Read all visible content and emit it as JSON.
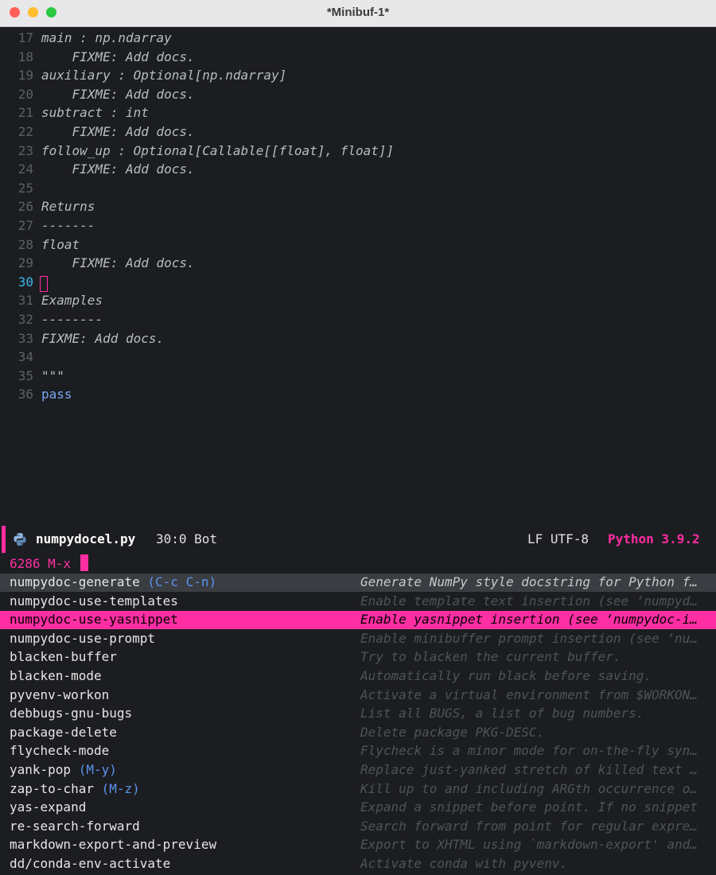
{
  "window": {
    "title": "*Minibuf-1*"
  },
  "editor": {
    "lines": [
      {
        "num": "17",
        "text": "main : np.ndarray"
      },
      {
        "num": "18",
        "text": "    FIXME: Add docs."
      },
      {
        "num": "19",
        "text": "auxiliary : Optional[np.ndarray]"
      },
      {
        "num": "20",
        "text": "    FIXME: Add docs."
      },
      {
        "num": "21",
        "text": "subtract : int"
      },
      {
        "num": "22",
        "text": "    FIXME: Add docs."
      },
      {
        "num": "23",
        "text": "follow_up : Optional[Callable[[float], float]]"
      },
      {
        "num": "24",
        "text": "    FIXME: Add docs."
      },
      {
        "num": "25",
        "text": ""
      },
      {
        "num": "26",
        "text": "Returns"
      },
      {
        "num": "27",
        "text": "-------"
      },
      {
        "num": "28",
        "text": "float"
      },
      {
        "num": "29",
        "text": "    FIXME: Add docs."
      },
      {
        "num": "30",
        "text": ""
      },
      {
        "num": "31",
        "text": "Examples"
      },
      {
        "num": "32",
        "text": "--------"
      },
      {
        "num": "33",
        "text": "FIXME: Add docs."
      },
      {
        "num": "34",
        "text": ""
      },
      {
        "num": "35",
        "text": "\"\"\""
      },
      {
        "num": "36",
        "text": "pass"
      }
    ]
  },
  "modeline": {
    "icon": "python-icon",
    "filename": "numpydocel.py",
    "position": "30:0 Bot",
    "encoding": "LF UTF-8",
    "language": "Python 3.9.2"
  },
  "minibuffer": {
    "prompt": "6286 M-x "
  },
  "candidates": [
    {
      "name": "numpydoc-generate",
      "key": "(C-c C-n)",
      "desc": "Generate NumPy style docstring for Python f…"
    },
    {
      "name": "numpydoc-use-templates",
      "key": "",
      "desc": "Enable template text insertion (see ‘numpyd…"
    },
    {
      "name": "numpydoc-use-yasnippet",
      "key": "",
      "desc": "Enable yasnippet insertion (see ‘numpydoc-i…"
    },
    {
      "name": "numpydoc-use-prompt",
      "key": "",
      "desc": "Enable minibuffer prompt insertion (see ‘nu…"
    },
    {
      "name": "blacken-buffer",
      "key": "",
      "desc": "Try to blacken the current buffer."
    },
    {
      "name": "blacken-mode",
      "key": "",
      "desc": "Automatically run black before saving."
    },
    {
      "name": "pyvenv-workon",
      "key": "",
      "desc": "Activate a virtual environment from $WORKON…"
    },
    {
      "name": "debbugs-gnu-bugs",
      "key": "",
      "desc": "List all BUGS, a list of bug numbers."
    },
    {
      "name": "package-delete",
      "key": "",
      "desc": "Delete package PKG-DESC."
    },
    {
      "name": "flycheck-mode",
      "key": "",
      "desc": "Flycheck is a minor mode for on-the-fly syn…"
    },
    {
      "name": "yank-pop",
      "key": "(M-y)",
      "desc": "Replace just-yanked stretch of killed text …"
    },
    {
      "name": "zap-to-char",
      "key": "(M-z)",
      "desc": "Kill up to and including ARGth occurrence o…"
    },
    {
      "name": "yas-expand",
      "key": "",
      "desc": "Expand a snippet before point. If no snippet"
    },
    {
      "name": "re-search-forward",
      "key": "",
      "desc": "Search forward from point for regular expre…"
    },
    {
      "name": "markdown-export-and-preview",
      "key": "",
      "desc": "Export to XHTML using `markdown-export' and…"
    },
    {
      "name": "dd/conda-env-activate",
      "key": "",
      "desc": "Activate conda with pyvenv."
    }
  ],
  "colors": {
    "accent": "#ff2ea3",
    "keybinding": "#5b93f0",
    "current_line_number": "#3bb8f0"
  }
}
